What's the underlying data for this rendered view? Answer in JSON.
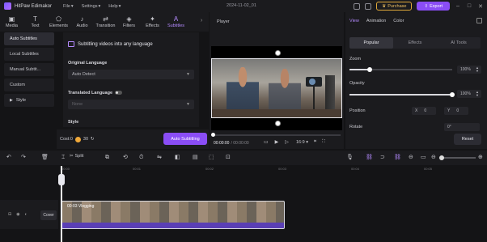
{
  "titlebar": {
    "app_name": "HitPaw Edimakor",
    "menu": [
      "File",
      "Settings",
      "Help"
    ],
    "document": "2024-11-02_01",
    "purchase_label": "Purchase",
    "export_label": "Export"
  },
  "toolbar_tabs": [
    {
      "label": "Media",
      "icon": "media-icon"
    },
    {
      "label": "Text",
      "icon": "text-icon"
    },
    {
      "label": "Elements",
      "icon": "elements-icon"
    },
    {
      "label": "Audio",
      "icon": "audio-icon"
    },
    {
      "label": "Transition",
      "icon": "transition-icon"
    },
    {
      "label": "Filters",
      "icon": "filters-icon"
    },
    {
      "label": "Effects",
      "icon": "effects-icon"
    },
    {
      "label": "Subtitles",
      "icon": "subtitles-icon",
      "active": true
    }
  ],
  "sidebar": {
    "items": [
      {
        "label": "Auto Subtitles",
        "active": true
      },
      {
        "label": "Local Subtitles"
      },
      {
        "label": "Manual Subtit..."
      },
      {
        "label": "Custom"
      },
      {
        "label": "Style",
        "expandable": true
      }
    ]
  },
  "subtitle_panel": {
    "heading": "Subtitling videos into any language",
    "original_language_label": "Original Language",
    "original_language_value": "Auto Detect",
    "translated_language_label": "Translated Language",
    "translated_language_value": "None",
    "style_label": "Style",
    "cost_label": "Cost:0",
    "coin_count": "30",
    "auto_button": "Auto Subtitling"
  },
  "player": {
    "title": "Player",
    "current_time": "00:00:00",
    "total_time": "/ 00:00:00",
    "ratio": "16:9"
  },
  "right_panel": {
    "tabs": [
      "View",
      "Animation",
      "Color"
    ],
    "active_tab": "View",
    "subtabs": [
      "Popular",
      "Effects",
      "AI Tools"
    ],
    "active_subtab": "Popular",
    "zoom_label": "Zoom",
    "zoom_value": "100%",
    "zoom_level": 0.2,
    "opacity_label": "Opacity",
    "opacity_value": "100%",
    "opacity_level": 1.0,
    "position_label": "Position",
    "pos_x_label": "X",
    "pos_x_value": "0",
    "pos_y_label": "Y",
    "pos_y_value": "0",
    "rotate_label": "Rotate",
    "rotate_value": "0°",
    "reset_label": "Reset"
  },
  "timeline": {
    "split_label": "Split",
    "ruler_ticks": [
      "00:00",
      "00:01",
      "00:02",
      "00:03",
      "00:04",
      "00:05",
      "00:06",
      "00:07"
    ],
    "cover_label": "Cover",
    "clip_label": "00:03 Vlogging"
  },
  "colors": {
    "accent": "#8a4df5",
    "purchase": "#e0a93a"
  }
}
